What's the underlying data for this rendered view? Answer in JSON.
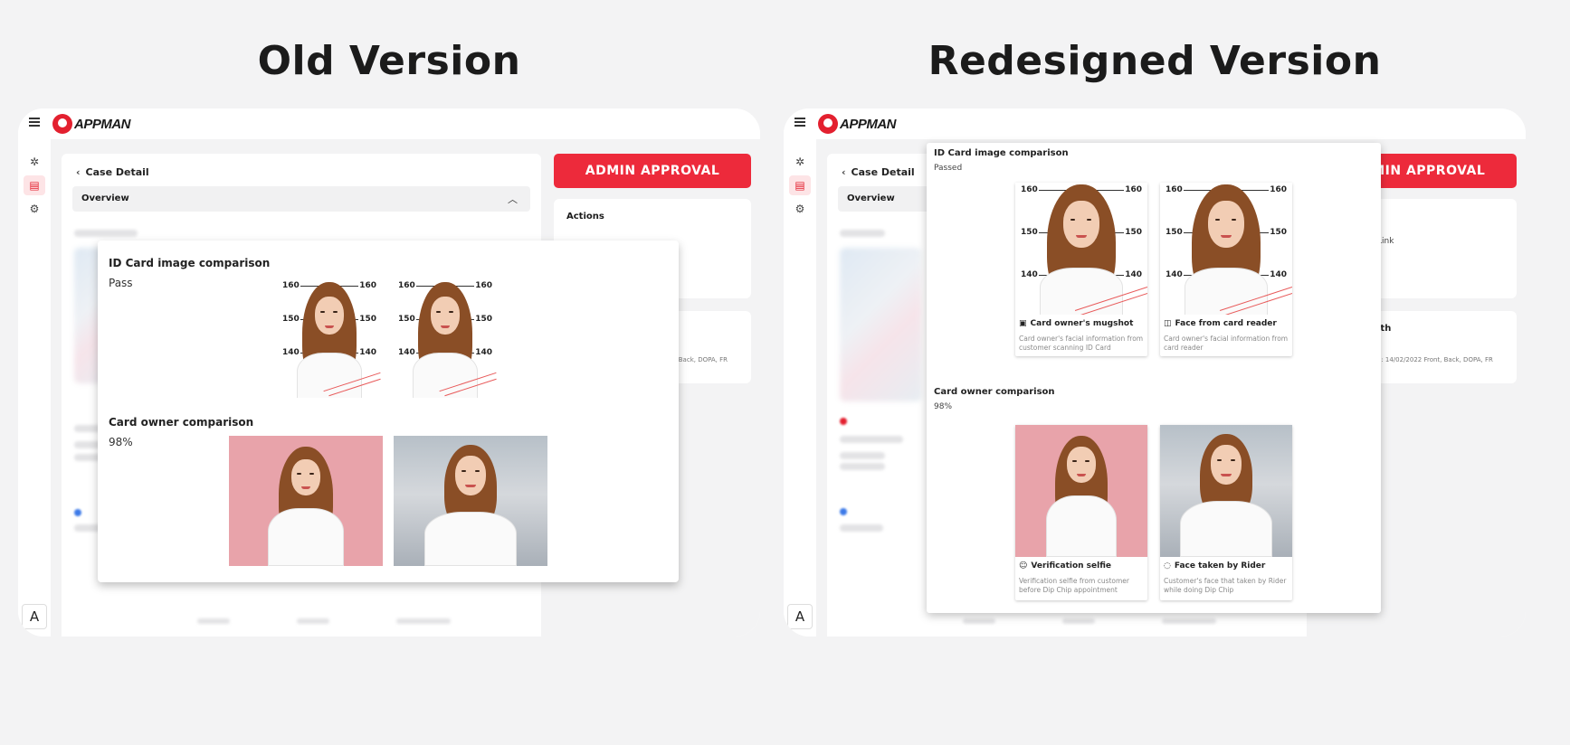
{
  "headings": {
    "old": "Old Version",
    "new": "Redesigned Version"
  },
  "app": {
    "logo_text": "APPMAN",
    "rail_bottom_label": "A"
  },
  "case": {
    "title": "Case Detail",
    "overview_label": "Overview",
    "admin_approval": "ADMIN APPROVAL",
    "actions_label": "Actions",
    "link_fragment": "Link",
    "with_fragment": "ith",
    "meta_fragment_old": "Back, DOPA, FR",
    "meta_fragment_new": "e: 14/02/2022  Front, Back, DOPA, FR"
  },
  "old_modal": {
    "id_card": {
      "title": "ID Card image comparison",
      "status": "Pass"
    },
    "owner": {
      "title": "Card owner comparison",
      "score": "98%"
    }
  },
  "new_modal": {
    "id_card": {
      "title": "ID Card image comparison",
      "status": "Passed",
      "photos": [
        {
          "icon": "id-badge-icon",
          "label": "Card owner's mugshot",
          "desc": "Card owner's facial information from customer scanning ID Card"
        },
        {
          "icon": "card-reader-icon",
          "label": "Face from card reader",
          "desc": "Card owner's facial information from card reader"
        }
      ]
    },
    "owner": {
      "title": "Card owner comparison",
      "score": "98%",
      "photos": [
        {
          "icon": "selfie-icon",
          "label": "Verification selfie",
          "desc": "Verification selfie from customer before Dip Chip appointment"
        },
        {
          "icon": "face-scan-icon",
          "label": "Face taken by Rider",
          "desc": "Customer's face that taken by Rider while doing Dip Chip"
        }
      ]
    }
  },
  "ruler_marks": [
    "160",
    "150",
    "140"
  ],
  "colors": {
    "brand_red": "#ed2a3b",
    "page_bg": "#f3f3f4",
    "active_rail": "#fde4e6"
  }
}
